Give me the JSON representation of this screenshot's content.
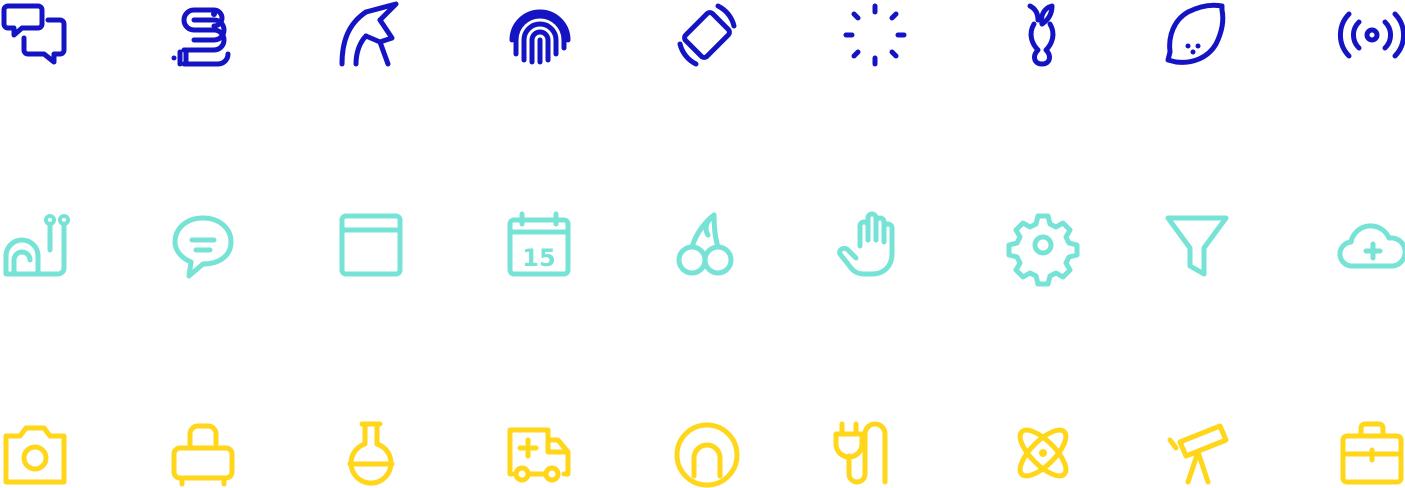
{
  "palette": {
    "row1": "#1414c4",
    "row2": "#76e3d6",
    "row3": "#ffd61a"
  },
  "rows": [
    {
      "icons": [
        "chat-bubbles-icon",
        "worm-icon",
        "unicorn-icon",
        "fingerprint-icon",
        "screen-rotation-icon",
        "loading-spinner-icon",
        "apple-core-icon",
        "lemon-icon",
        "broadcast-icon"
      ]
    },
    {
      "icons": [
        "snail-icon",
        "speech-bubble-icon",
        "browser-window-icon",
        "calendar-icon",
        "cherries-icon",
        "raised-hand-icon",
        "gear-icon",
        "funnel-icon",
        "cloud-add-icon"
      ]
    },
    {
      "icons": [
        "camera-icon",
        "toaster-icon",
        "flask-icon",
        "ambulance-icon",
        "power-button-icon",
        "plug-cable-icon",
        "atom-icon",
        "telescope-icon",
        "toolbox-icon"
      ]
    }
  ],
  "calendar": {
    "day": "15"
  }
}
